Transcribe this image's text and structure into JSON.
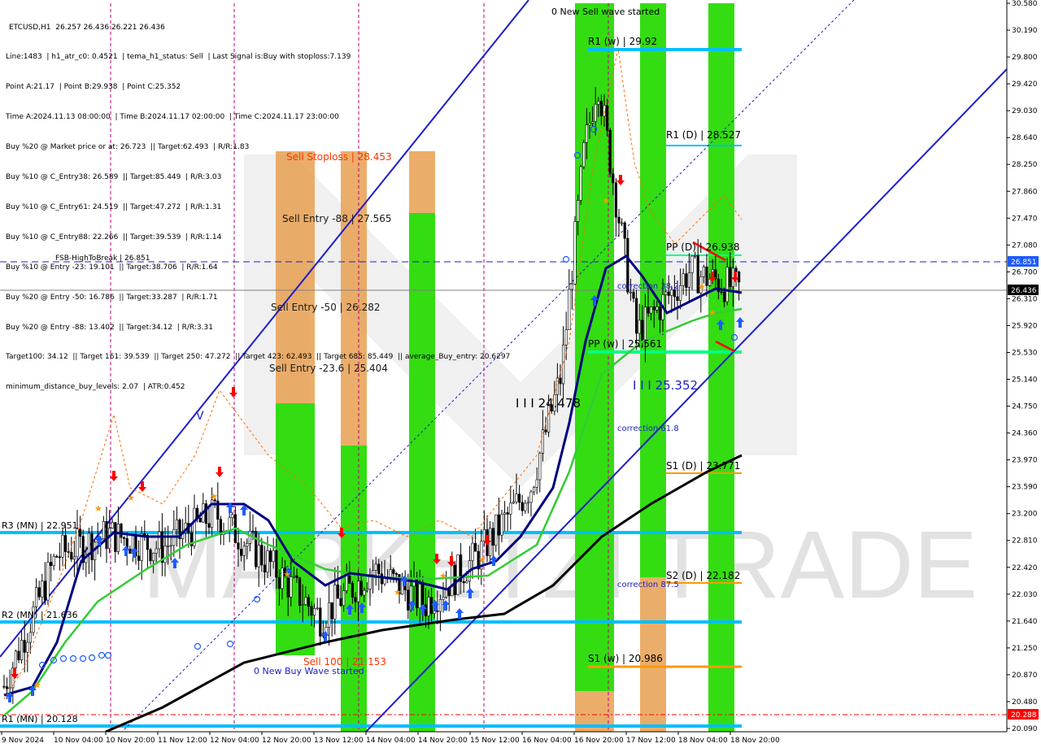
{
  "header": {
    "symbol_line": "ETCUSD,H1  26.257 26.436 26.221 26.436",
    "info_lines": [
      "Line:1483  | h1_atr_c0: 0.4521  | tema_h1_status: Sell  | Last Signal is:Buy with stoploss:7.139",
      "Point A:21.17  | Point B:29.938  | Point C:25.352",
      "Time A:2024.11.13 08:00:00  | Time B:2024.11.17 02:00:00  | Time C:2024.11.17 23:00:00",
      "Buy %20 @ Market price or at: 26.723  || Target:62.493  | R/R:1.83",
      "Buy %10 @ C_Entry38: 26.589  || Target:85.449  | R/R:3.03",
      "Buy %10 @ C_Entry61: 24.519  || Target:47.272  | R/R:1.31",
      "Buy %10 @ C_Entry88: 22.266  || Target:39.539  | R/R:1.14",
      "Buy %10 @ Entry -23: 19.101  || Target:38.706  | R/R:1.64",
      "Buy %20 @ Entry -50: 16.786  || Target:33.287  | R/R:1.71",
      "Buy %20 @ Entry -88: 13.402  || Target:34.12  | R/R:3.31",
      "Target100: 34.12  || Target 161: 39.539  || Target 250: 47.272  || Target 423: 62.493  || Target 685: 85.449  || average_Buy_entry: 20.6297",
      "minimum_distance_buy_levels: 2.07  | ATR:0.452"
    ]
  },
  "price_axis": {
    "ticks": [
      "30.580",
      "30.190",
      "29.800",
      "29.420",
      "29.030",
      "28.640",
      "28.250",
      "27.860",
      "27.470",
      "27.080",
      "26.700",
      "26.310",
      "25.920",
      "25.530",
      "25.140",
      "24.750",
      "24.360",
      "23.970",
      "23.590",
      "23.200",
      "22.810",
      "22.420",
      "22.030",
      "21.640",
      "21.250",
      "20.870",
      "20.480",
      "20.090"
    ],
    "current_price": "26.436",
    "fsb_price": "26.851",
    "red_price": "20.288"
  },
  "time_axis": {
    "ticks": [
      "9 Nov 2024",
      "10 Nov 04:00",
      "10 Nov 20:00",
      "11 Nov 12:00",
      "12 Nov 04:00",
      "12 Nov 20:00",
      "13 Nov 12:00",
      "14 Nov 04:00",
      "14 Nov 20:00",
      "15 Nov 12:00",
      "16 Nov 04:00",
      "16 Nov 20:00",
      "17 Nov 12:00",
      "18 Nov 04:00",
      "18 Nov 20:00"
    ]
  },
  "labels": {
    "new_sell_wave": "0 New Sell wave started",
    "new_buy_wave": "0 New Buy Wave started",
    "r1_w": "R1 (w) | 29.92",
    "r1_d": "R1 (D) | 28.527",
    "pp_d": "PP (D) | 26.938",
    "pp_w": "PP (w) | 25.561",
    "s1_d": "S1 (D) | 23.771",
    "s2_d": "S2 (D) | 22.182",
    "s1_w": "S1 (w) | 20.986",
    "r3_mn": "R3 (MN) | 22.951",
    "r2_mn": "R2 (MN) | 21.636",
    "r1_mn": "R1 (MN) | 20.128",
    "fsb": "FSB-HighToBreak | 26.851",
    "sell_stoploss": "Sell Stoploss | 28.453",
    "sell_entry_88": "Sell Entry -88 | 27.565",
    "sell_entry_50": "Sell Entry -50 | 26.282",
    "sell_entry_23": "Sell Entry -23.6 | 25.404",
    "sell_100": "Sell 100 | 21.153",
    "wave_c": "I I I 25.352",
    "wave_b": "I I I 24.478",
    "corr_38": "correction 38.2",
    "corr_61": "correction 61.8",
    "corr_87": "correction 87.5",
    "watermark": "MARKETZI TRADE",
    "sell_marker": "V"
  },
  "colors": {
    "green_zone": "#33dd11",
    "orange_zone": "#e8a050",
    "level_line": "#00bfff",
    "channel": "#0000cc",
    "ma_navy": "#000080",
    "ma_green": "#33cc33",
    "ma_black": "#000000",
    "buy_arrow": "#1e5bff",
    "sell_arrow": "#ff0000",
    "current_price_bg": "#000000",
    "fsb_bg": "#1e5bff",
    "red_price_bg": "#ff0000"
  },
  "chart_data": {
    "type": "candlestick",
    "symbol": "ETCUSD",
    "timeframe": "H1",
    "ylim": [
      20.09,
      30.58
    ],
    "close_path": [
      {
        "t": "9 Nov 2024",
        "p": 20.7
      },
      {
        "t": "10 Nov 04:00",
        "p": 22.6
      },
      {
        "t": "10 Nov 20:00",
        "p": 22.9
      },
      {
        "t": "11 Nov 12:00",
        "p": 22.7
      },
      {
        "t": "12 Nov 04:00",
        "p": 23.2
      },
      {
        "t": "12 Nov 20:00",
        "p": 22.5
      },
      {
        "t": "13 Nov 12:00",
        "p": 21.7
      },
      {
        "t": "14 Nov 04:00",
        "p": 22.4
      },
      {
        "t": "14 Nov 20:00",
        "p": 21.9
      },
      {
        "t": "15 Nov 12:00",
        "p": 22.6
      },
      {
        "t": "16 Nov 04:00",
        "p": 23.6
      },
      {
        "t": "16 Nov 20:00",
        "p": 28.4
      },
      {
        "t": "17 Nov 12:00",
        "p": 25.8
      },
      {
        "t": "18 Nov 04:00",
        "p": 26.7
      },
      {
        "t": "18 Nov 20:00",
        "p": 26.436
      }
    ],
    "levels": [
      {
        "name": "R1 (w)",
        "value": 29.92
      },
      {
        "name": "R1 (D)",
        "value": 28.527
      },
      {
        "name": "PP (D)",
        "value": 26.938
      },
      {
        "name": "PP (w)",
        "value": 25.561
      },
      {
        "name": "S1 (D)",
        "value": 23.771
      },
      {
        "name": "S2 (D)",
        "value": 22.182
      },
      {
        "name": "S1 (w)",
        "value": 20.986
      },
      {
        "name": "R3 (MN)",
        "value": 22.951
      },
      {
        "name": "R2 (MN)",
        "value": 21.636
      },
      {
        "name": "R1 (MN)",
        "value": 20.128
      }
    ]
  }
}
